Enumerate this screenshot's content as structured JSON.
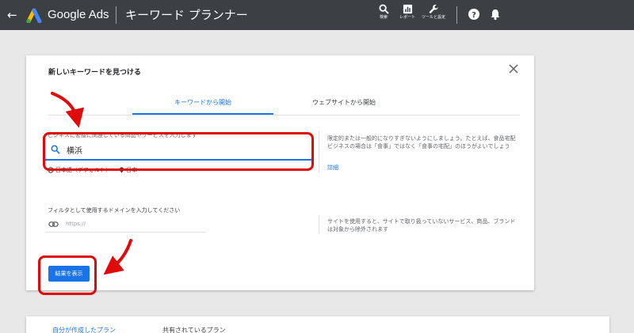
{
  "topbar": {
    "back_icon": "arrow-left-icon",
    "brand": "Google Ads",
    "page_title": "キーワード プランナー",
    "tools": [
      {
        "label": "検索",
        "icon": "search-icon"
      },
      {
        "label": "レポート",
        "icon": "reports-icon"
      },
      {
        "label": "ツールと設定",
        "icon": "wrench-icon"
      }
    ],
    "help_icon": "help-icon",
    "notifications_icon": "bell-icon"
  },
  "card": {
    "title": "新しいキーワードを見つける",
    "close_icon": "close-icon",
    "tabs": [
      {
        "label": "キーワードから開始",
        "active": true
      },
      {
        "label": "ウェブサイトから開始",
        "active": false
      }
    ],
    "keyword_section": {
      "label": "ビジネスに密接に関連している商品やサービスを入力します",
      "value": "横浜",
      "language": "日本語（デフォルト）",
      "location": "日本",
      "hint": "限定的または一般的になりすぎないようにしましょう。たとえば、食品宅配ビジネスの場合は「食事」ではなく「食事の宅配」のほうがよいでしょう",
      "detail_link": "詳細"
    },
    "domain_section": {
      "label": "フィルタとして使用するドメインを入力してください",
      "placeholder": "https://",
      "hint": "サイトを使用すると、サイトで取り扱っていないサービス、商品、ブランドは対象から除外されます"
    },
    "submit_label": "結果を表示"
  },
  "bottom_tabs": [
    {
      "label": "自分が作成したプラン",
      "active": true
    },
    {
      "label": "共有されているプラン",
      "active": false
    }
  ],
  "colors": {
    "topbar": "#3c4043",
    "accent": "#1a73e8",
    "annotation": "#e10a0a",
    "background": "#e8e8e8"
  }
}
